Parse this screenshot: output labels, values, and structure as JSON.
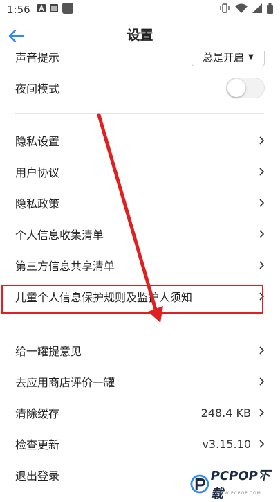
{
  "status_bar": {
    "time": "1:56"
  },
  "header": {
    "title": "设置"
  },
  "settings": {
    "sound_prompt": {
      "label": "声音提示",
      "value": "总是开启"
    },
    "night_mode": {
      "label": "夜间模式",
      "enabled": false
    },
    "privacy": [
      {
        "label": "隐私设置"
      },
      {
        "label": "用户协议"
      },
      {
        "label": "隐私政策"
      },
      {
        "label": "个人信息收集清单"
      },
      {
        "label": "第三方信息共享清单"
      },
      {
        "label": "儿童个人信息保护规则及监护人须知"
      }
    ],
    "feedback": {
      "label": "给一罐提意见"
    },
    "rate_app": {
      "label": "去应用商店评价一罐"
    },
    "clear_cache": {
      "label": "清除缓存",
      "value": "248.4 KB"
    },
    "check_update": {
      "label": "检查更新",
      "value": "v3.15.10"
    },
    "logout": {
      "label": "退出登录"
    }
  },
  "watermark": {
    "text": "PCPOP下载",
    "subtext": "WWW.PCPOP.COM"
  },
  "colors": {
    "accent": "#2f8bf0",
    "annotation": "#e02020"
  }
}
